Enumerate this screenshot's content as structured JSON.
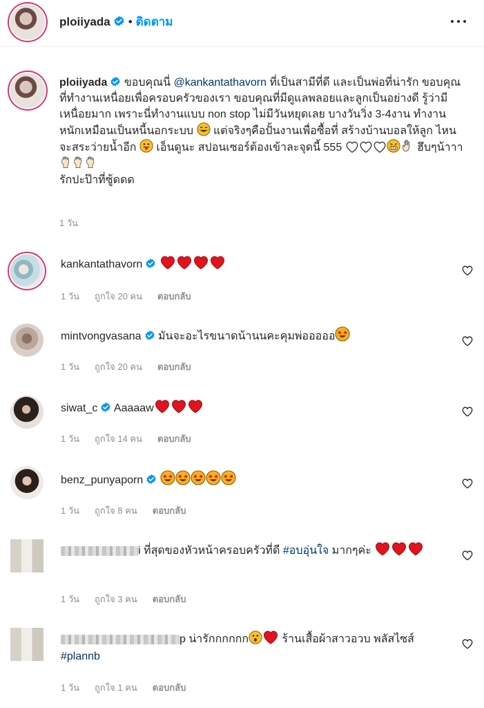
{
  "header": {
    "username": "ploiiyada",
    "separator": "•",
    "follow_label": "ติดตาม"
  },
  "caption": {
    "username": "ploiiyada",
    "text_1": "ขอบคุณนี่",
    "mention": "@kankantathavorn",
    "text_2": "ที่เป็นสามีที่ดี และเป็นพ่อที่น่ารัก ขอบคุณที่ทำงานเหนื่อยเพื่อครอบครัวของเรา ขอบคุณที่มีดูแลพลอยและลูกเป็นอย่างดี รู้ว่ามีเหนื่อยมาก เพราะนี่ทำงานแบบ non stop ไม่มีวันหยุดเลย บางวันวิ่ง 3-4งาน ทำงานหนักเหมือนเป็นหนี้นอกระบบ",
    "text_3": "แต่จริงๆคือปั้นงานเพื่อซื้อที่ สร้างบ้านบอลให้ลูก ไหนจะสระว่ายน้ำอีก",
    "text_4": "เอ็นดูนะ สปอนเซอร์ต้องเข้าละจุดนี้ 555",
    "text_5": "ฮึบๆน้าาา",
    "text_6": "รักปะป๊าที่ซู้ดดด",
    "time": "1 วัน"
  },
  "comments": [
    {
      "username": "kankantathavorn",
      "text": "",
      "time": "1 วัน",
      "likes": "ถูกใจ 20 คน",
      "reply": "ตอบกลับ"
    },
    {
      "username": "mintvongvasana",
      "text": "มันจะอะไรขนาดน้านนคะคุมพ่อออออ",
      "time": "1 วัน",
      "likes": "ถูกใจ 20 คน",
      "reply": "ตอบกลับ"
    },
    {
      "username": "siwat_c",
      "text": "Aaaaaw",
      "time": "1 วัน",
      "likes": "ถูกใจ 14 คน",
      "reply": "ตอบกลับ"
    },
    {
      "username": "benz_punyaporn",
      "text": "",
      "time": "1 วัน",
      "likes": "ถูกใจ 8 คน",
      "reply": "ตอบกลับ"
    },
    {
      "username_tail": "i",
      "text": "ที่สุดของหัวหน้าครอบครัวที่ดี",
      "hashtag": "#อบอุ่นใจ",
      "text_2": "มากๆค่ะ",
      "time": "1 วัน",
      "likes": "ถูกใจ 3 คน",
      "reply": "ตอบกลับ"
    },
    {
      "username_tail": "p",
      "text": "น่ารักกกกกก",
      "text_2": "ร้านเสื้อผ้าสาวอวบ พลัสไซส์",
      "hashtag": "#plannb",
      "time": "1 วัน",
      "likes": "ถูกใจ 1 คน",
      "reply": "ตอบกลับ"
    }
  ],
  "colors": {
    "accent": "#0095f6",
    "heart": "#ed1c24",
    "link": "#00376b",
    "muted": "#8e8e8e"
  },
  "icons": [
    "verified-badge-icon",
    "more-options-icon",
    "heart-outline-icon",
    "red-heart-emoji",
    "white-heart-emoji",
    "star-eyes-emoji",
    "laughing-emoji",
    "tongue-emoji",
    "hand-emoji",
    "fist-emoji"
  ]
}
